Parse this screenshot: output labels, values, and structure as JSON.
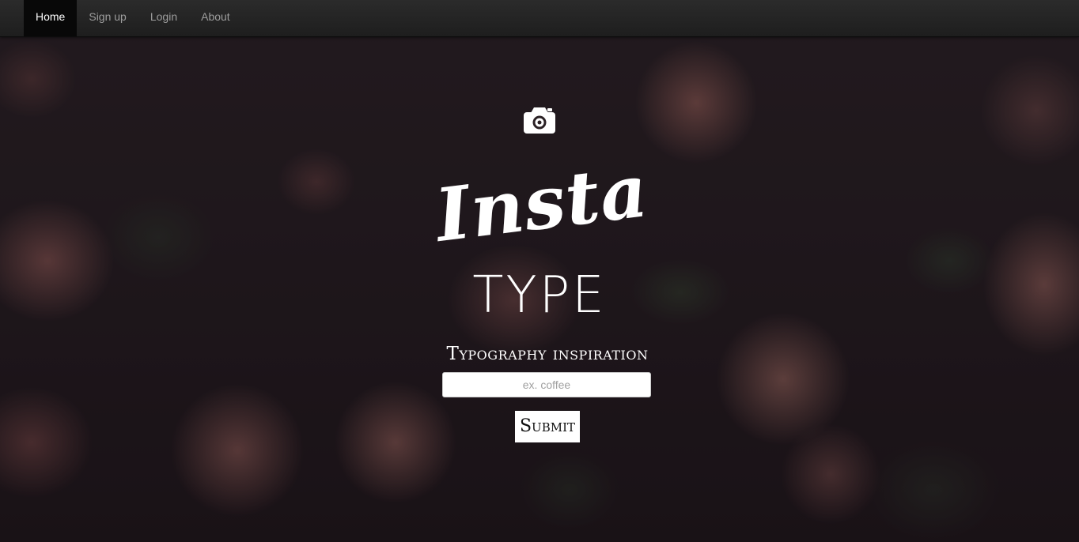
{
  "nav": {
    "items": [
      {
        "label": "Home",
        "active": true
      },
      {
        "label": "Sign up",
        "active": false
      },
      {
        "label": "Login",
        "active": false
      },
      {
        "label": "About",
        "active": false
      }
    ]
  },
  "hero": {
    "icon": "camera-icon",
    "logo_top": "Insta",
    "logo_bottom": "TYPE",
    "subtitle": "Typography inspiration",
    "search": {
      "placeholder": "ex. coffee",
      "value": ""
    },
    "submit_label": "Submit"
  },
  "colors": {
    "navbar": "#222222",
    "nav_active": "#080808",
    "nav_text": "#9d9d9d",
    "nav_text_active": "#ffffff",
    "hero_text": "#ffffff"
  }
}
